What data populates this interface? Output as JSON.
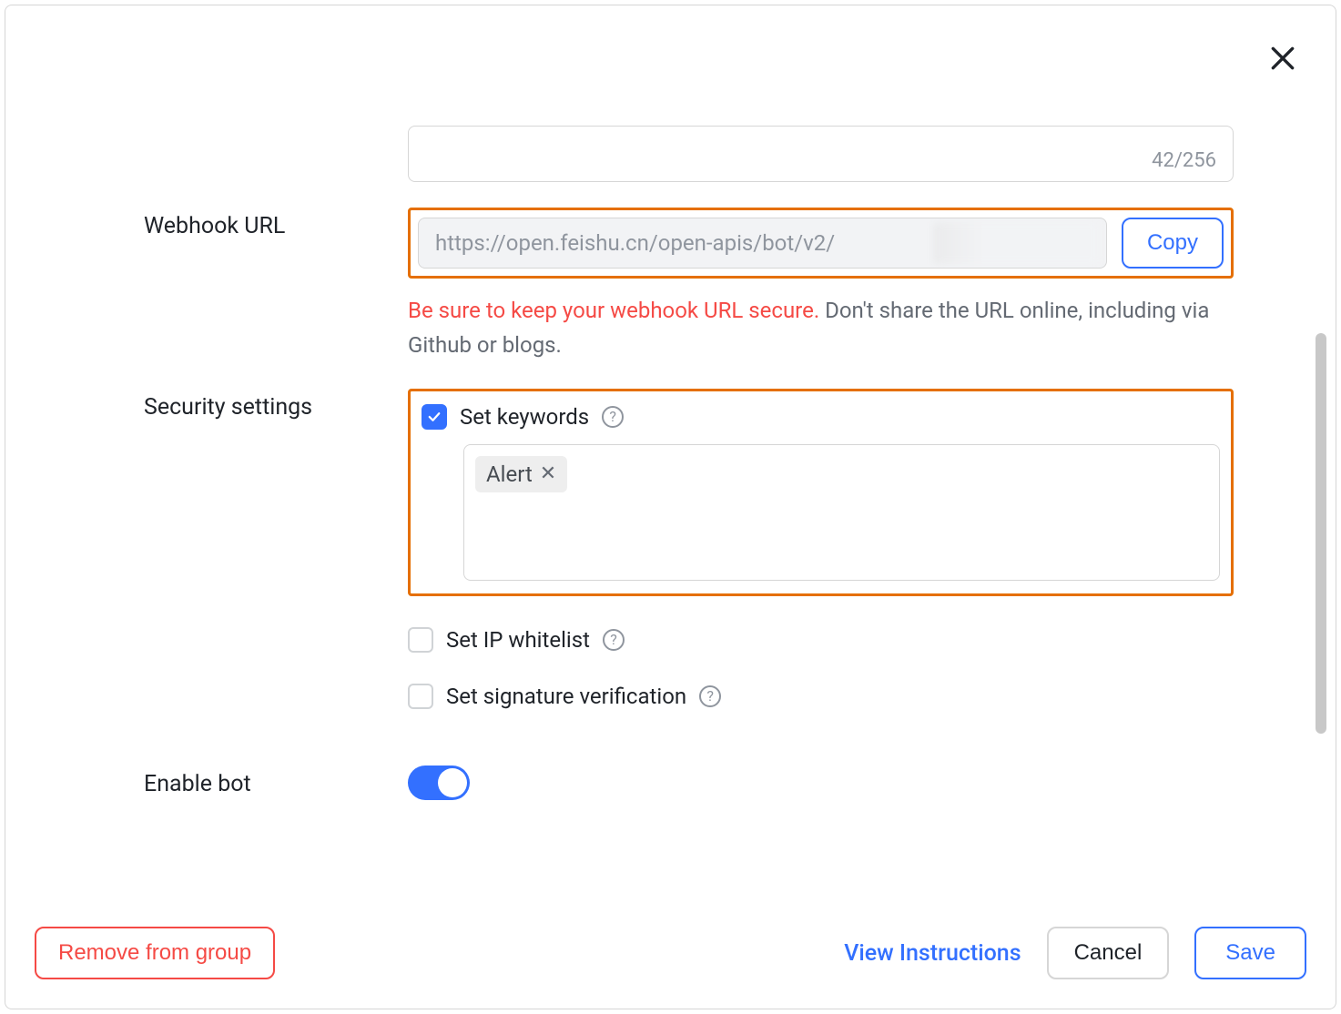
{
  "charCounter": "42/256",
  "labels": {
    "webhookUrl": "Webhook URL",
    "securitySettings": "Security settings",
    "enableBot": "Enable bot"
  },
  "webhook": {
    "value": "https://open.feishu.cn/open-apis/bot/v2/",
    "copy": "Copy",
    "warning_red": "Be sure to keep your webhook URL secure. ",
    "warning_gray": "Don't share the URL online, including via Github or blogs."
  },
  "security": {
    "setKeywords": "Set keywords",
    "setIpWhitelist": "Set IP whitelist",
    "setSignatureVerification": "Set signature verification",
    "keyword": "Alert"
  },
  "footer": {
    "remove": "Remove from group",
    "viewInstructions": "View Instructions",
    "cancel": "Cancel",
    "save": "Save"
  }
}
